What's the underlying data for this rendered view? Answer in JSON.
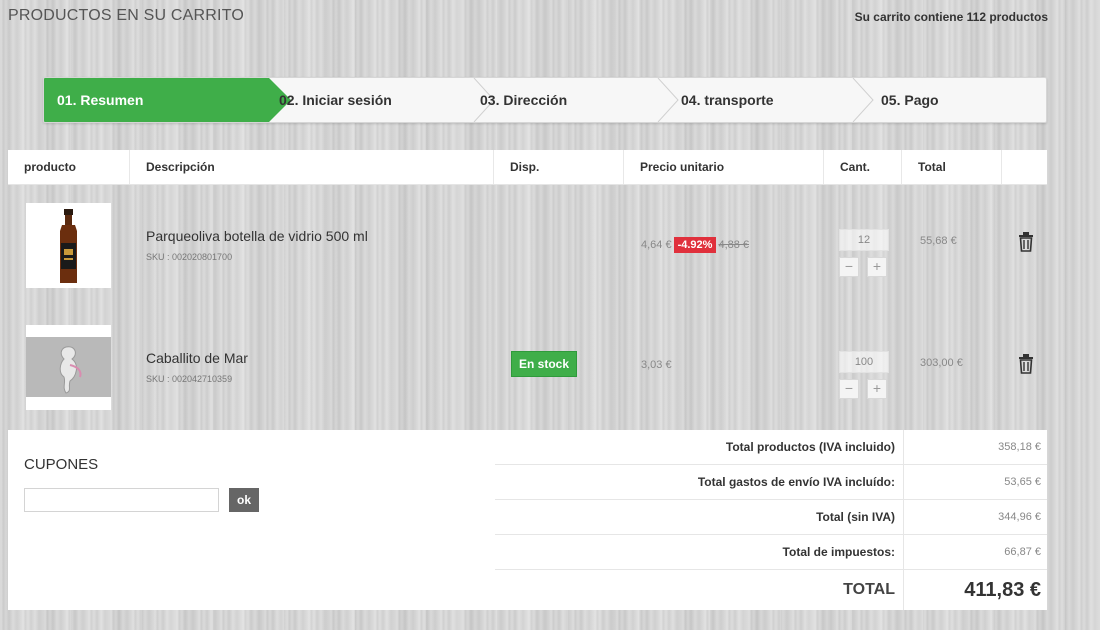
{
  "page": {
    "title": "PRODUCTOS EN SU CARRITO",
    "cart_count": "Su carrito contiene 112 productos"
  },
  "steps": [
    {
      "label": "01. Resumen",
      "active": true
    },
    {
      "label": "02. Iniciar sesión",
      "active": false
    },
    {
      "label": "03. Dirección",
      "active": false
    },
    {
      "label": "04. transporte",
      "active": false
    },
    {
      "label": "05. Pago",
      "active": false
    }
  ],
  "table": {
    "headers": [
      "producto",
      "Descripción",
      "Disp.",
      "Precio unitario",
      "Cant.",
      "Total",
      ""
    ],
    "rows": [
      {
        "name": "Parqueoliva botella de vidrio 500 ml",
        "sku": "SKU : 002020801700",
        "availability": "",
        "price": "4,64 €",
        "discount": "-4.92%",
        "old_price": "4,88 €",
        "quantity": "12",
        "total": "55,68 €"
      },
      {
        "name": "Caballito de Mar",
        "sku": "SKU : 002042710359",
        "availability": "En stock",
        "price": "3,03 €",
        "discount": "",
        "old_price": "",
        "quantity": "100",
        "total": "303,00 €"
      }
    ]
  },
  "coupons": {
    "title": "CUPONES",
    "input_value": "",
    "button": "ok"
  },
  "totals": [
    {
      "label": "Total productos (IVA incluido)",
      "value": "358,18 €"
    },
    {
      "label": "Total gastos de envío IVA incluído:",
      "value": "53,65 €"
    },
    {
      "label": "Total (sin IVA)",
      "value": "344,96 €"
    },
    {
      "label": "Total de impuestos:",
      "value": "66,87 €"
    },
    {
      "label": "TOTAL",
      "value": "411,83 €"
    }
  ],
  "colors": {
    "accent_green": "#3fae49",
    "discount_red": "#e0303c"
  },
  "icons": {
    "delete": "trash-icon",
    "decrease": "minus-icon",
    "increase": "plus-icon"
  }
}
